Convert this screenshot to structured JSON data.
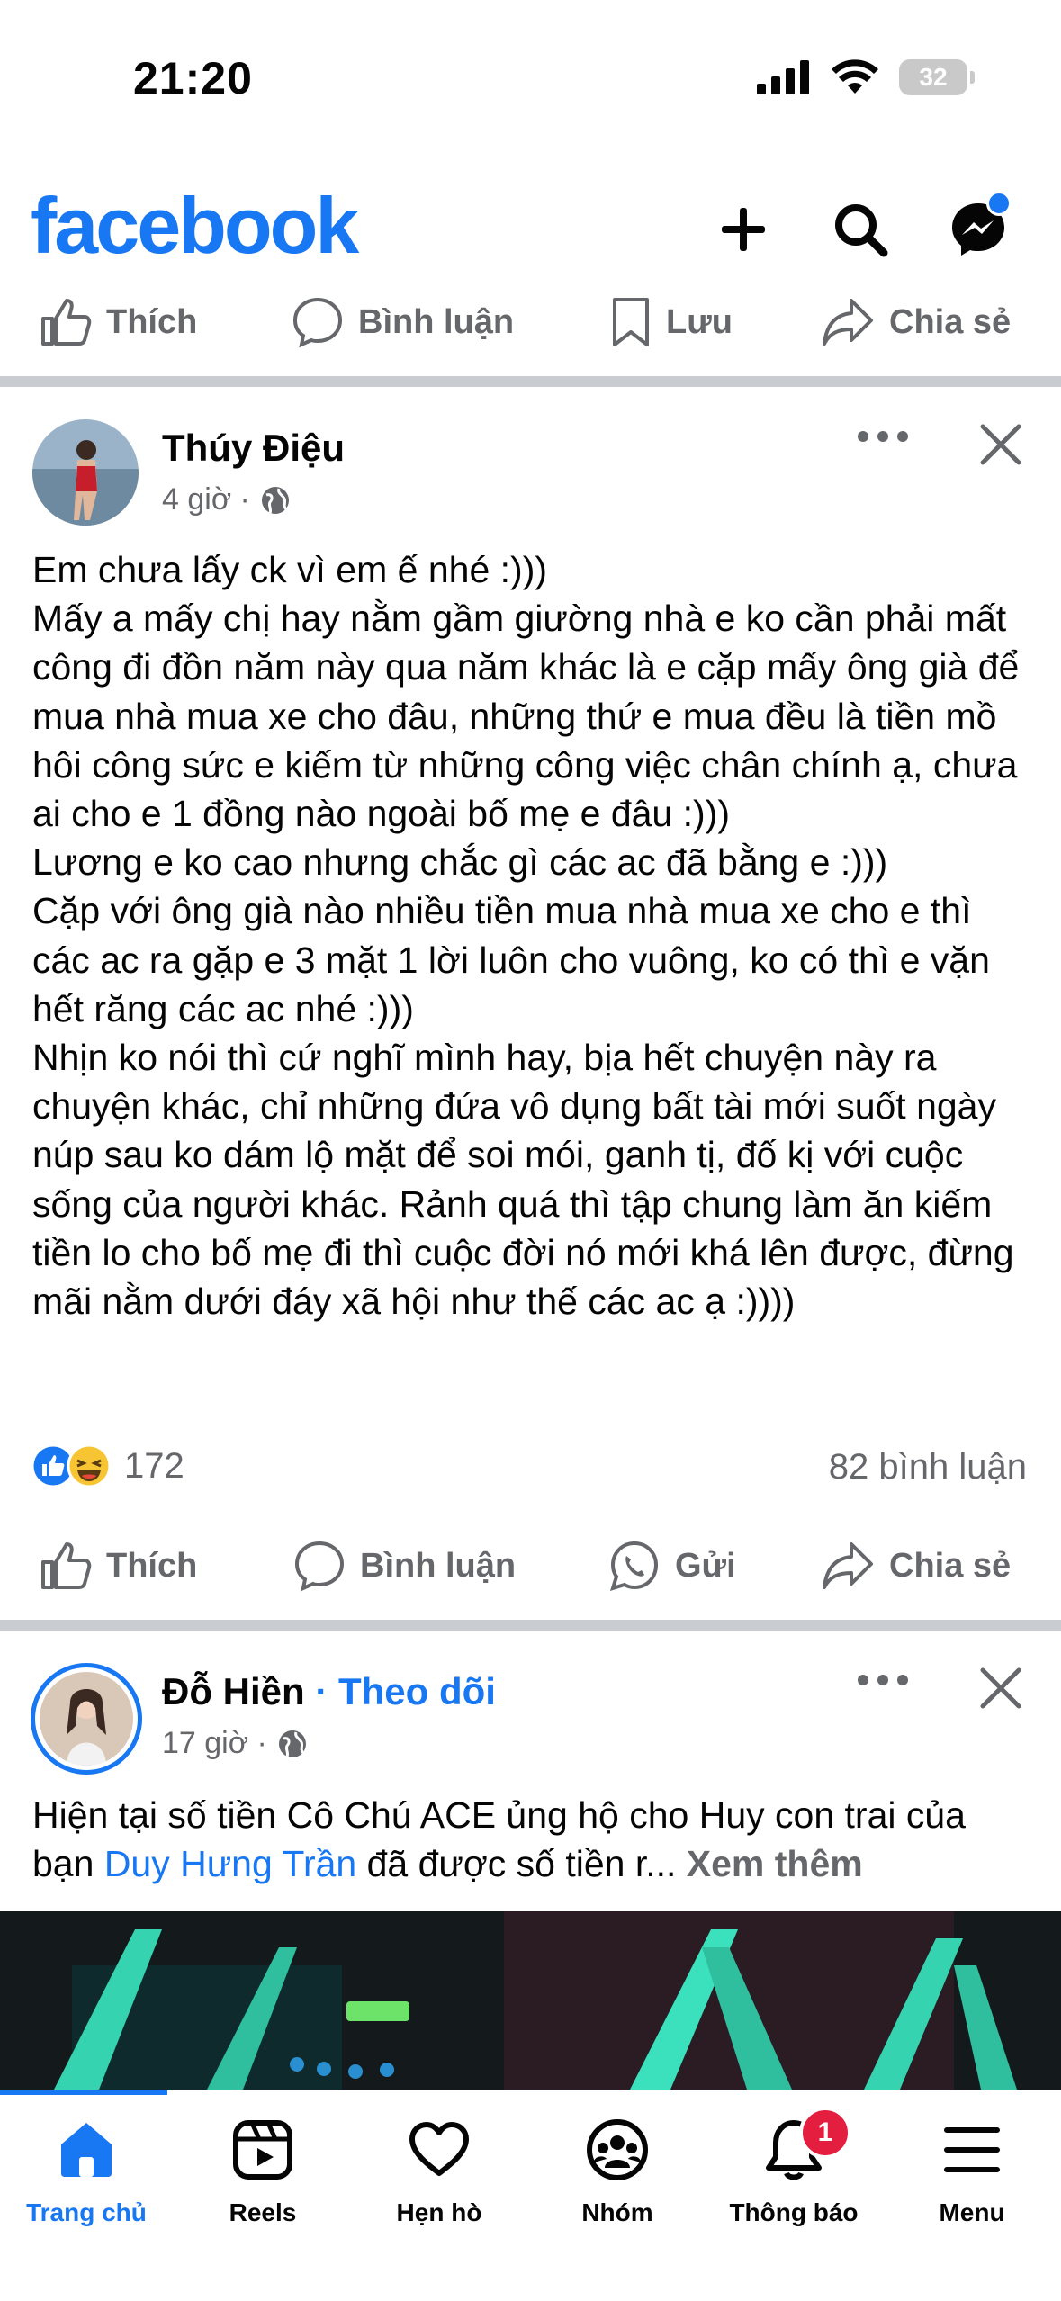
{
  "status": {
    "time": "21:20",
    "battery": "32"
  },
  "header": {
    "logo": "facebook"
  },
  "top_actions": {
    "like": "Thích",
    "comment": "Bình luận",
    "save": "Lưu",
    "share": "Chia sẻ"
  },
  "post1": {
    "author": "Thúy Điệu",
    "time": "4 giờ ·",
    "text": "Em chưa lấy ck vì em ế nhé :)))\nMấy a mấy chị hay nằm gầm giường nhà e ko cần phải mất công đi đồn năm này qua năm khác là e cặp mấy ông già để mua nhà mua xe cho đâu, những thứ e mua đều là tiền mồ hôi công sức e kiếm từ những công việc chân chính ạ, chưa ai cho e 1 đồng nào ngoài bố mẹ e đâu :)))\nLương e ko cao nhưng chắc gì các ac đã bằng e :)))\nCặp với ông già nào nhiều tiền mua nhà mua xe cho e thì các ac ra gặp e 3 mặt 1 lời luôn cho vuông, ko có thì e vặn hết răng các ac nhé :)))\nNhịn ko nói thì cứ nghĩ mình hay, bịa hết chuyện này ra chuyện khác, chỉ những đứa vô dụng bất tài mới suốt ngày núp sau ko dám lộ mặt để soi mói, ganh tị, đố kị với cuộc sống của người khác. Rảnh quá thì tập chung làm ăn kiếm tiền lo cho bố mẹ đi thì cuộc đời nó mới khá lên được, đừng mãi nằm dưới đáy xã hội như thế các ac ạ :))))",
    "reactions_count": "172",
    "comments_count": "82 bình luận",
    "actions": {
      "like": "Thích",
      "comment": "Bình luận",
      "send": "Gửi",
      "share": "Chia sẻ"
    }
  },
  "post2": {
    "author": "Đỗ Hiền",
    "follow": "· Theo dõi",
    "time": "17 giờ ·",
    "text_a": "Hiện tại số tiền Cô Chú ACE ủng hộ cho Huy con trai của bạn ",
    "mention": "Duy Hưng Trần",
    "text_b": " đã được số tiền r... ",
    "see_more": "Xem thêm"
  },
  "tabs": [
    {
      "label": "Trang chủ",
      "icon": "home-icon"
    },
    {
      "label": "Reels",
      "icon": "reels-icon"
    },
    {
      "label": "Hẹn hò",
      "icon": "heart-icon"
    },
    {
      "label": "Nhóm",
      "icon": "groups-icon"
    },
    {
      "label": "Thông báo",
      "icon": "bell-icon",
      "badge": "1"
    },
    {
      "label": "Menu",
      "icon": "menu-icon"
    }
  ],
  "colors": {
    "brand": "#1877f2",
    "text": "#050505",
    "secondary": "#65676b",
    "badge": "#e41e3f"
  }
}
